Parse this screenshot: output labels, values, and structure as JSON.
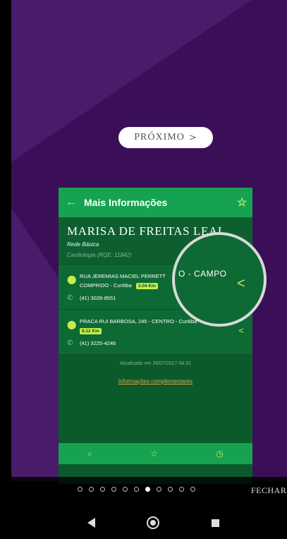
{
  "onboarding": {
    "next_label": "PRÓXIMO",
    "close_label": "FECHAR",
    "page_count": 11,
    "active_page_index": 6
  },
  "card": {
    "header_title": "Mais Informações",
    "doctor_name": "MARISA DE FREITAS LEAL",
    "network": "Rede Básica",
    "specialty": "Cardiologia (RQE: 11842)",
    "addresses": [
      {
        "line1": "RUA JEREMIAS MACIEL PERRETT",
        "line2": "COMPRIDO - Curitiba",
        "distance": "3.04 Km",
        "phone": "(41) 3028-8551"
      },
      {
        "line1": "PRACA RUI BARBOSA, 245 - CENTRO - Curitiba",
        "line2": "",
        "distance": "8.12 Km",
        "phone": "(41) 3225-4246"
      }
    ],
    "updated": "Atualizado em 26/07/2017 04:31",
    "more_info_link": "Informações complementares",
    "magnifier_text": "O - CAMPO"
  },
  "colors": {
    "background": "#4a1a6b",
    "header_green": "#17a251",
    "card_green": "#0a5a2c",
    "accent_lime": "#c3ec4d",
    "link_orange": "#e8a44a"
  },
  "icons": {
    "back": "arrow-left-icon",
    "favorite": "star-icon",
    "location": "map-pin-icon",
    "phone": "phone-icon",
    "share": "share-icon",
    "search": "search-icon",
    "history": "clock-icon"
  }
}
